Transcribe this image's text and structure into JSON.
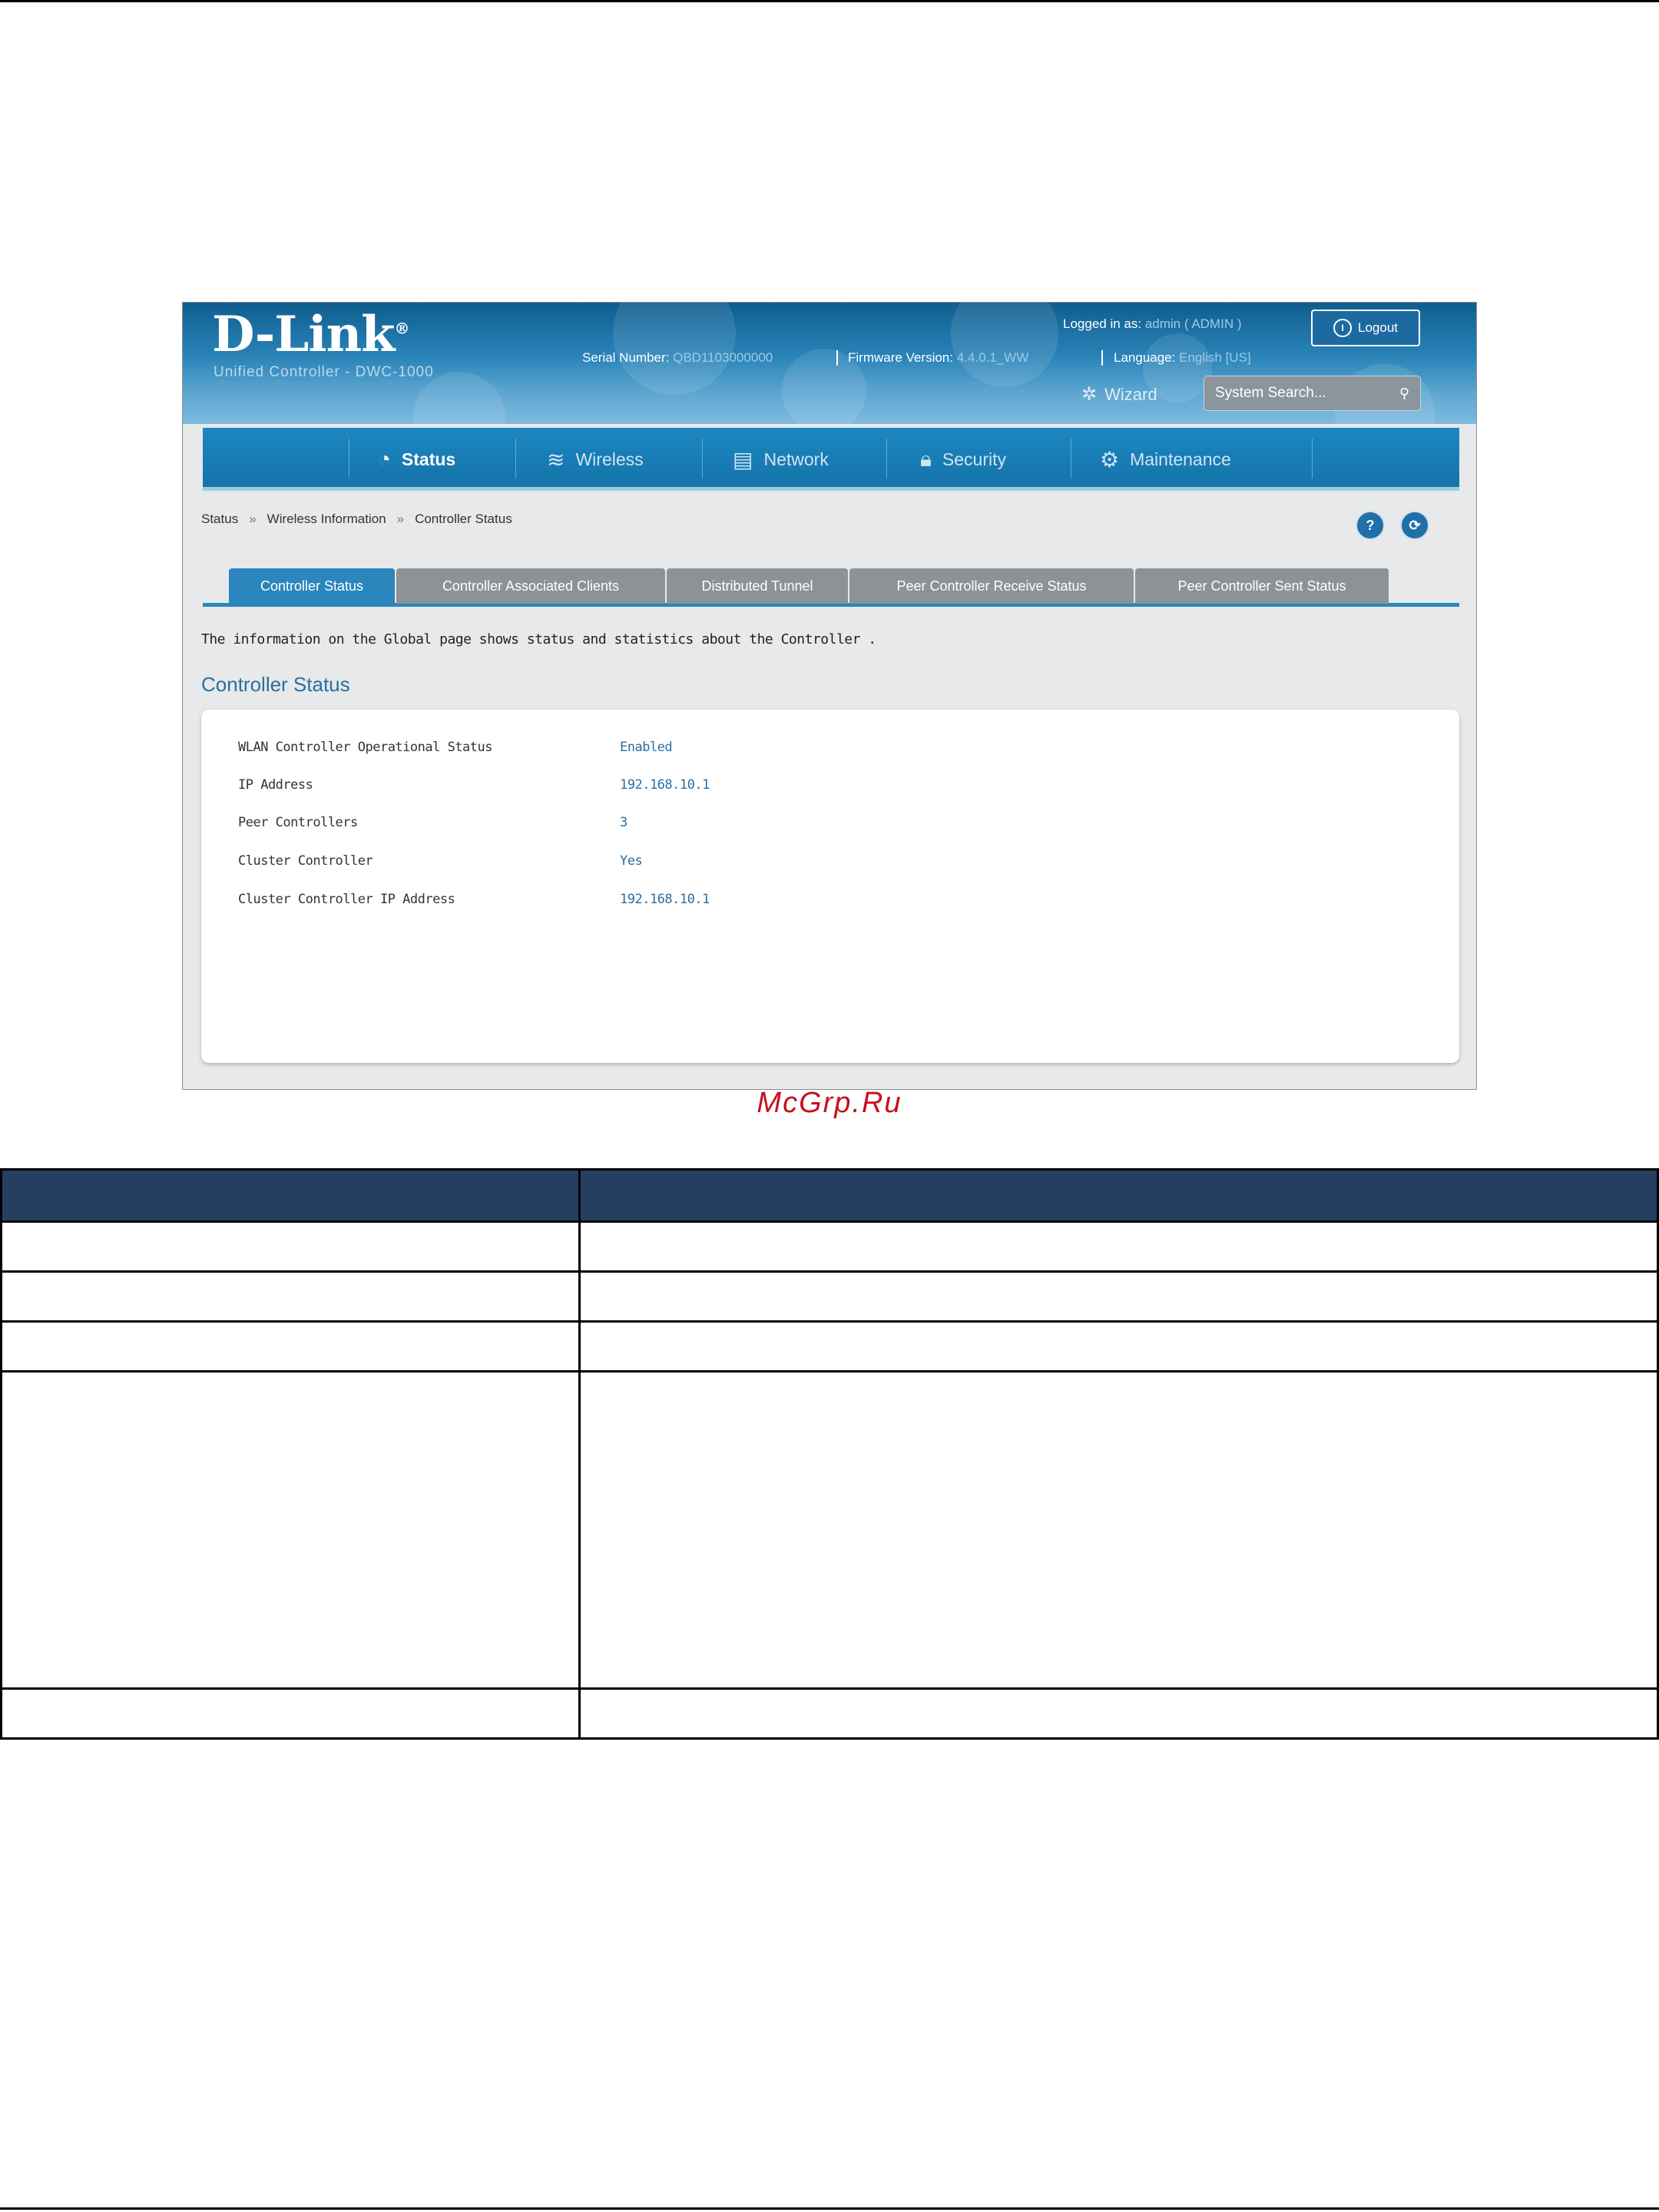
{
  "header": {
    "logo": "D-Link",
    "logo_mark": "®",
    "subtitle": "Unified Controller - DWC-1000",
    "logged_in_label": "Logged in as:",
    "logged_in_user": "admin",
    "logged_in_role": "( ADMIN )",
    "logout_label": "Logout",
    "serial_label": "Serial Number:",
    "serial_value": "QBD1103000000",
    "firmware_label": "Firmware Version:",
    "firmware_value": "4.4.0.1_WW",
    "language_label": "Language:",
    "language_value": "English [US]",
    "wizard_label": "Wizard",
    "search_placeholder": "System Search..."
  },
  "nav": {
    "items": [
      {
        "label": "Status",
        "icon": "gauge-icon",
        "active": true
      },
      {
        "label": "Wireless",
        "icon": "wifi-icon",
        "active": false
      },
      {
        "label": "Network",
        "icon": "network-icon",
        "active": false
      },
      {
        "label": "Security",
        "icon": "lock-icon",
        "active": false
      },
      {
        "label": "Maintenance",
        "icon": "gear-icon",
        "active": false
      }
    ]
  },
  "breadcrumb": [
    "Status",
    "Wireless Information",
    "Controller Status"
  ],
  "breadcrumb_separator": "»",
  "help_icon_glyph": "?",
  "refresh_icon_glyph": "⟳",
  "tabs": [
    {
      "label": "Controller Status",
      "active": true
    },
    {
      "label": "Controller Associated Clients",
      "active": false
    },
    {
      "label": "Distributed Tunnel",
      "active": false
    },
    {
      "label": "Peer Controller Receive Status",
      "active": false
    },
    {
      "label": "Peer Controller Sent Status",
      "active": false
    }
  ],
  "description": "The information on the Global page shows status and statistics about the Controller .",
  "section_title": "Controller Status",
  "status_rows": [
    {
      "label": "WLAN Controller Operational Status",
      "value": "Enabled"
    },
    {
      "label": "IP Address",
      "value": "192.168.10.1"
    },
    {
      "label": "Peer Controllers",
      "value": "3"
    },
    {
      "label": "Cluster Controller",
      "value": "Yes"
    },
    {
      "label": "Cluster Controller IP Address",
      "value": "192.168.10.1"
    }
  ],
  "watermark": "McGrp.Ru",
  "colors": {
    "header_blue": "#1573aa",
    "tab_active": "#2a86bd",
    "tab_inactive": "#8d9296",
    "value_blue": "#2d6d9d",
    "table_header": "#243f5f",
    "watermark_red": "#c8101c"
  }
}
